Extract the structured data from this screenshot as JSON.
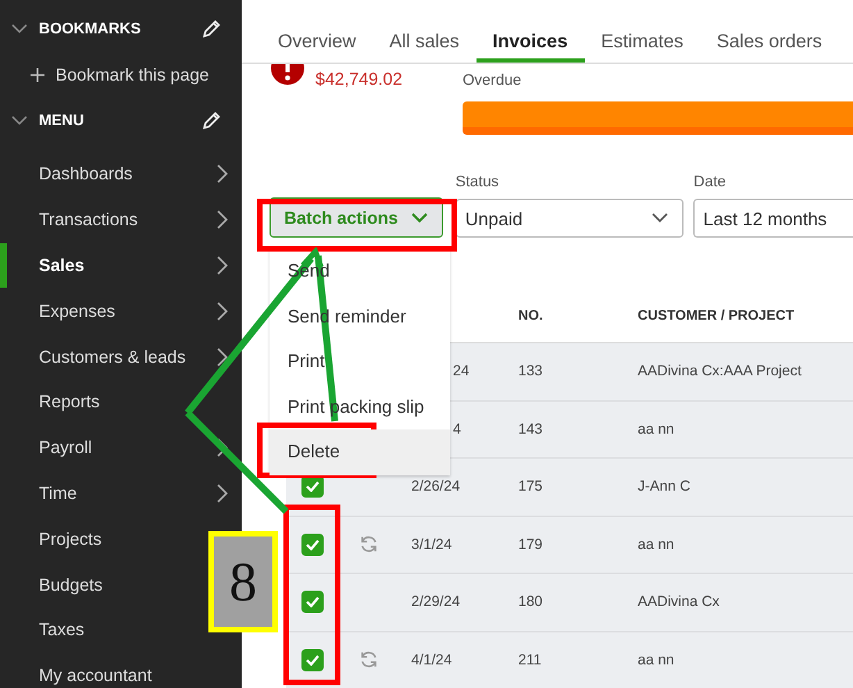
{
  "sidebar": {
    "bookmarks": {
      "title": "BOOKMARKS",
      "action": "Bookmark this page"
    },
    "menu": {
      "title": "MENU",
      "items": [
        {
          "label": "Dashboards",
          "selected": false,
          "has_submenu": true
        },
        {
          "label": "Transactions",
          "selected": false,
          "has_submenu": true
        },
        {
          "label": "Sales",
          "selected": true,
          "has_submenu": true
        },
        {
          "label": "Expenses",
          "selected": false,
          "has_submenu": true
        },
        {
          "label": "Customers & leads",
          "selected": false,
          "has_submenu": true
        },
        {
          "label": "Reports",
          "selected": false,
          "has_submenu": false
        },
        {
          "label": "Payroll",
          "selected": false,
          "has_submenu": true
        },
        {
          "label": "Time",
          "selected": false,
          "has_submenu": true
        },
        {
          "label": "Projects",
          "selected": false,
          "has_submenu": false
        },
        {
          "label": "Budgets",
          "selected": false,
          "has_submenu": false
        },
        {
          "label": "Taxes",
          "selected": false,
          "has_submenu": false
        },
        {
          "label": "My accountant",
          "selected": false,
          "has_submenu": false
        }
      ]
    }
  },
  "tabs": [
    {
      "label": "Overview",
      "selected": false
    },
    {
      "label": "All sales",
      "selected": false
    },
    {
      "label": "Invoices",
      "selected": true
    },
    {
      "label": "Estimates",
      "selected": false
    },
    {
      "label": "Sales orders",
      "selected": false
    }
  ],
  "summary": {
    "amount": "$42,749.02",
    "label": "Overdue"
  },
  "batch_button": "Batch actions",
  "filters": [
    {
      "label": "Status",
      "value": "Unpaid"
    },
    {
      "label": "Date",
      "value": "Last 12 months"
    }
  ],
  "batch_menu": [
    {
      "label": "Send",
      "highlighted": false
    },
    {
      "label": "Send reminder",
      "highlighted": false
    },
    {
      "label": "Print",
      "highlighted": false
    },
    {
      "label": "Print packing slip",
      "highlighted": false
    },
    {
      "label": "Delete",
      "highlighted": true
    }
  ],
  "table": {
    "columns": [
      "NO.",
      "CUSTOMER / PROJECT"
    ],
    "rows": [
      {
        "partial": true,
        "recurring": false,
        "date": "24",
        "no": "133",
        "customer": "AADivina Cx:AAA Project"
      },
      {
        "partial": true,
        "recurring": false,
        "date": "4",
        "no": "143",
        "customer": "aa nn"
      },
      {
        "partial": false,
        "checked": true,
        "recurring": false,
        "date": "2/26/24",
        "no": "175",
        "customer": "J-Ann C"
      },
      {
        "partial": false,
        "checked": true,
        "recurring": true,
        "date": "3/1/24",
        "no": "179",
        "customer": "aa nn"
      },
      {
        "partial": false,
        "checked": true,
        "recurring": false,
        "date": "2/29/24",
        "no": "180",
        "customer": "AADivina Cx"
      },
      {
        "partial": false,
        "checked": true,
        "recurring": true,
        "date": "4/1/24",
        "no": "211",
        "customer": "aa nn"
      }
    ]
  },
  "step_number": "8"
}
